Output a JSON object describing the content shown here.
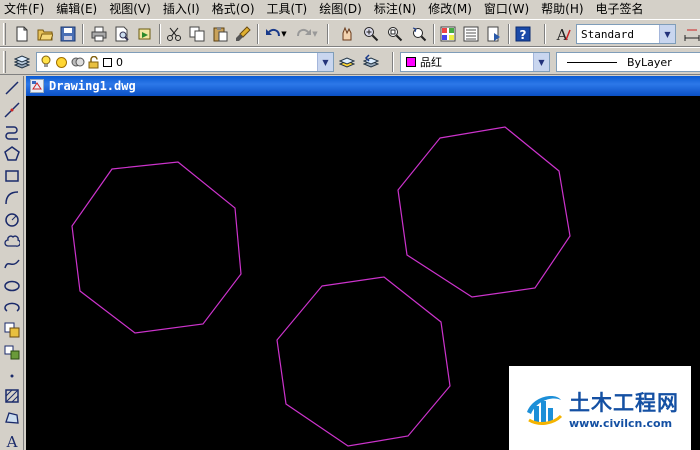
{
  "menu": [
    {
      "label": "文件(F)"
    },
    {
      "label": "编辑(E)"
    },
    {
      "label": "视图(V)"
    },
    {
      "label": "插入(I)"
    },
    {
      "label": "格式(O)"
    },
    {
      "label": "工具(T)"
    },
    {
      "label": "绘图(D)"
    },
    {
      "label": "标注(N)"
    },
    {
      "label": "修改(M)"
    },
    {
      "label": "窗口(W)"
    },
    {
      "label": "帮助(H)"
    },
    {
      "label": "电子签名"
    }
  ],
  "standard_toolbar": {
    "text_style_value": "Standard"
  },
  "layer_toolbar": {
    "layer_value": "0",
    "color_value": "品红",
    "color_swatch": "#ff00ff",
    "linetype_value": "ByLayer"
  },
  "drawing": {
    "title": "Drawing1.dwg",
    "background": "#000000",
    "stroke_color": "#cc33cc",
    "octagons": 3
  },
  "watermark": {
    "title": "土木工程网",
    "url": "www.civilcn.com"
  },
  "colors": {
    "chrome": "#d4d0c8",
    "titlebar": "#0a5bd3",
    "watermark_blue": "#1450a3"
  }
}
